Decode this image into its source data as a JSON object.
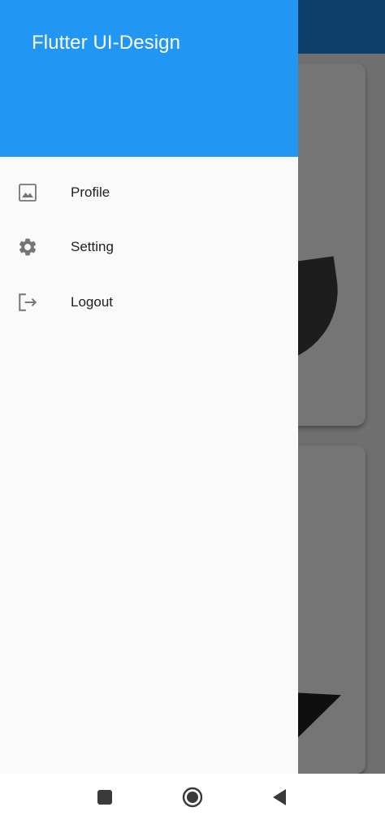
{
  "drawer": {
    "title": "Flutter UI-Design",
    "items": [
      {
        "label": "Profile",
        "icon": "image-icon"
      },
      {
        "label": "Setting",
        "icon": "gear-icon"
      },
      {
        "label": "Logout",
        "icon": "logout-icon"
      }
    ]
  },
  "navbar": {
    "recents": "recents-button",
    "home": "home-button",
    "back": "back-button"
  },
  "colors": {
    "drawer_header": "#2196f3",
    "appbar": "#1e88e5",
    "drawer_bg": "#fafafa",
    "icon_gray": "#757575",
    "scrim": "rgba(0,0,0,0.54)"
  }
}
